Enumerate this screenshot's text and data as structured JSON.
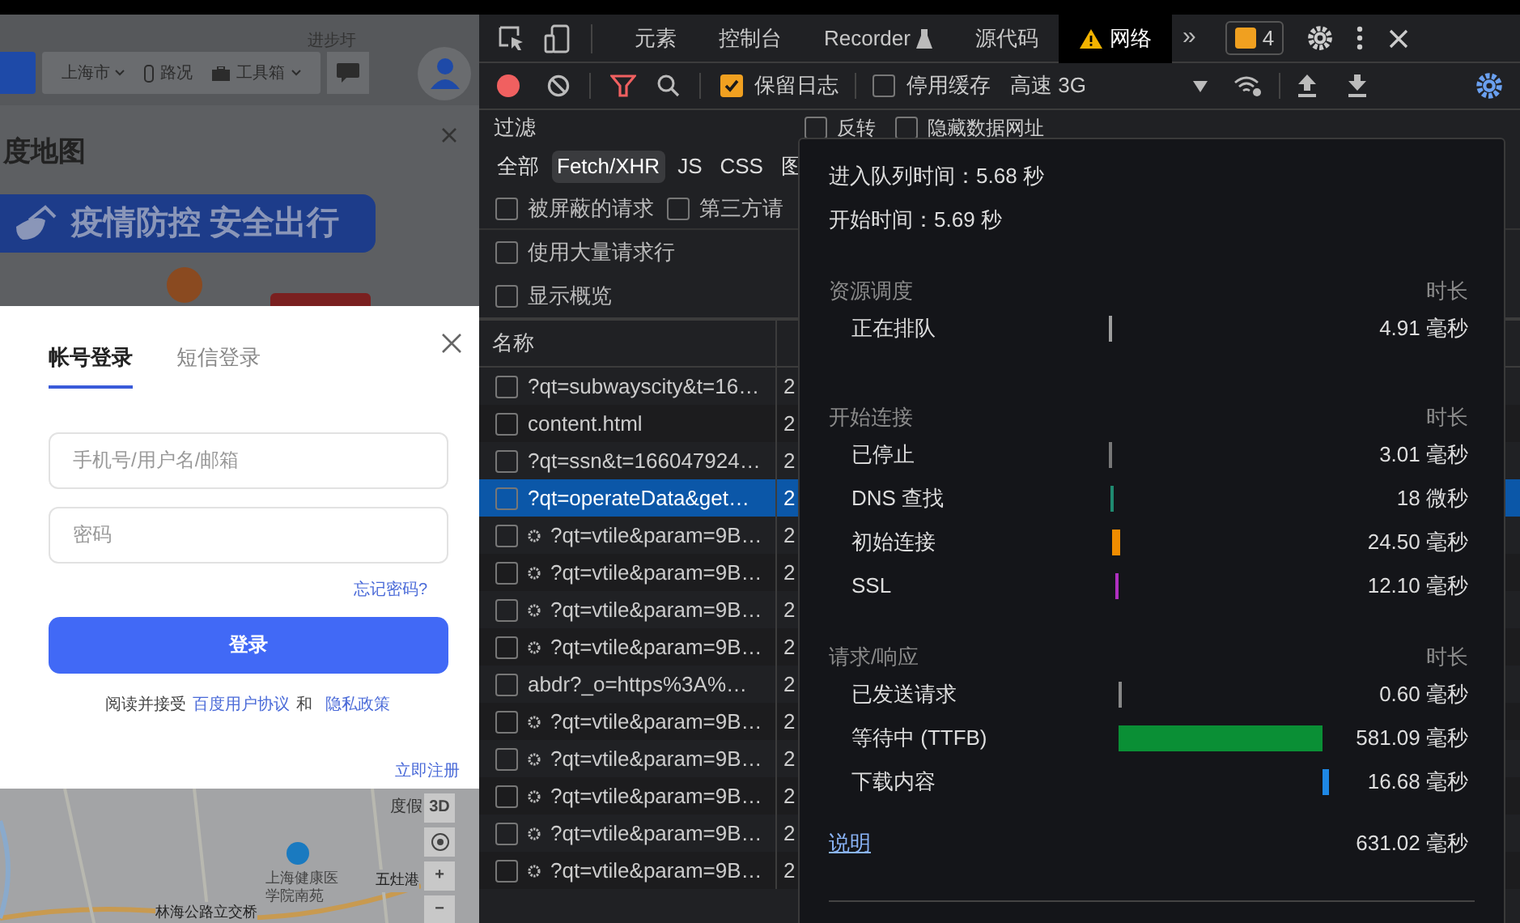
{
  "map": {
    "city": "上海市",
    "traffic": "路况",
    "toolbox": "工具箱",
    "top_label": "进步圩",
    "logo": "度地图",
    "banner": "疫情防控 安全出行",
    "bottom_labels": [
      "度假",
      "上海健康医学院南苑",
      "五灶港",
      "林海公路立交桥"
    ],
    "controls": [
      {
        "kind": "text",
        "label": "3D"
      },
      {
        "kind": "locate"
      },
      {
        "kind": "text",
        "label": "+"
      },
      {
        "kind": "text",
        "label": "−"
      }
    ]
  },
  "login": {
    "tabs": [
      {
        "label": "帐号登录",
        "selected": true
      },
      {
        "label": "短信登录",
        "selected": false
      }
    ],
    "fields": [
      {
        "placeholder": "手机号/用户名/邮箱"
      },
      {
        "placeholder": "密码"
      }
    ],
    "forgot": "忘记密码?",
    "submit": "登录",
    "agreement": {
      "prefix": "阅读并接受",
      "link1": "百度用户协议",
      "joiner": "和",
      "link2": "隐私政策"
    },
    "register": "立即注册"
  },
  "devtools": {
    "tabs": [
      {
        "label": "元素",
        "selected": false,
        "kind": "plain"
      },
      {
        "label": "控制台",
        "selected": false,
        "kind": "plain"
      },
      {
        "label": "Recorder",
        "selected": false,
        "kind": "flask"
      },
      {
        "label": "源代码",
        "selected": false,
        "kind": "plain"
      },
      {
        "label": "网络",
        "selected": true,
        "kind": "warning"
      }
    ],
    "more": "»",
    "issues": "4",
    "preserve_log": {
      "label": "保留日志",
      "checked": true
    },
    "disable_cache": {
      "label": "停用缓存",
      "checked": false
    },
    "throttling": "高速 3G",
    "filter_label": "过滤",
    "filter_options": [
      {
        "label": "反转",
        "checked": false
      },
      {
        "label": "隐藏数据网址",
        "checked": false
      }
    ],
    "types": [
      {
        "label": "全部",
        "selected": false
      },
      {
        "label": "Fetch/XHR",
        "selected": true
      },
      {
        "label": "JS",
        "selected": false
      },
      {
        "label": "CSS",
        "selected": false
      },
      {
        "label": "图",
        "selected": false
      }
    ],
    "checks": [
      {
        "label": "被屏蔽的请求",
        "checked": false
      },
      {
        "label": "第三方请",
        "checked": false
      },
      {
        "label": "使用大量请求行",
        "checked": false
      },
      {
        "label": "显示概览",
        "checked": false
      }
    ],
    "columns": [
      "名称"
    ],
    "rows": [
      {
        "name": "?qt=subwayscity&t=16…",
        "status": "2",
        "kind": "plain",
        "selected": false
      },
      {
        "name": "content.html",
        "status": "2",
        "kind": "plain",
        "selected": false
      },
      {
        "name": "?qt=ssn&t=166047924…",
        "status": "2",
        "kind": "plain",
        "selected": false
      },
      {
        "name": "?qt=operateData&get…",
        "status": "2",
        "kind": "plain",
        "selected": true
      },
      {
        "name": "?qt=vtile&param=9B…",
        "status": "2",
        "kind": "gear",
        "selected": false
      },
      {
        "name": "?qt=vtile&param=9B…",
        "status": "2",
        "kind": "gear",
        "selected": false
      },
      {
        "name": "?qt=vtile&param=9B…",
        "status": "2",
        "kind": "gear",
        "selected": false
      },
      {
        "name": "?qt=vtile&param=9B…",
        "status": "2",
        "kind": "gear",
        "selected": false
      },
      {
        "name": "abdr?_o=https%3A%…",
        "status": "2",
        "kind": "plain",
        "selected": false
      },
      {
        "name": "?qt=vtile&param=9B…",
        "status": "2",
        "kind": "gear",
        "selected": false
      },
      {
        "name": "?qt=vtile&param=9B…",
        "status": "2",
        "kind": "gear",
        "selected": false
      },
      {
        "name": "?qt=vtile&param=9B…",
        "status": "2",
        "kind": "gear",
        "selected": false
      },
      {
        "name": "?qt=vtile&param=9B…",
        "status": "2",
        "kind": "gear",
        "selected": false
      },
      {
        "name": "?qt=vtile&param=9B…",
        "status": "2",
        "kind": "gear",
        "selected": false
      }
    ]
  },
  "timing": {
    "queued": "进入队列时间：5.68 秒",
    "started": "开始时间：5.69 秒",
    "sections": [
      {
        "title": "资源调度",
        "duration_label": "时长",
        "items": [
          {
            "label": "正在排队",
            "value": "4.91 毫秒",
            "color": "#9e9e9e"
          }
        ]
      },
      {
        "title": "开始连接",
        "duration_label": "时长",
        "items": [
          {
            "label": "已停止",
            "value": "3.01 毫秒",
            "color": "#777777"
          },
          {
            "label": "DNS 查找",
            "value": "18 微秒",
            "color": "#1f8a70"
          },
          {
            "label": "初始连接",
            "value": "24.50 毫秒",
            "color": "#f08c00"
          },
          {
            "label": "SSL",
            "value": "12.10 毫秒",
            "color": "#b030c0"
          }
        ]
      },
      {
        "title": "请求/响应",
        "duration_label": "时长",
        "items": [
          {
            "label": "已发送请求",
            "value": "0.60 毫秒",
            "color": "#888888"
          },
          {
            "label": "等待中 (TTFB)",
            "value": "581.09 毫秒",
            "color": "#0a8f35"
          },
          {
            "label": "下载内容",
            "value": "16.68 毫秒",
            "color": "#1e88e5"
          }
        ]
      }
    ],
    "explanation": "说明",
    "total": "631.02 毫秒"
  }
}
